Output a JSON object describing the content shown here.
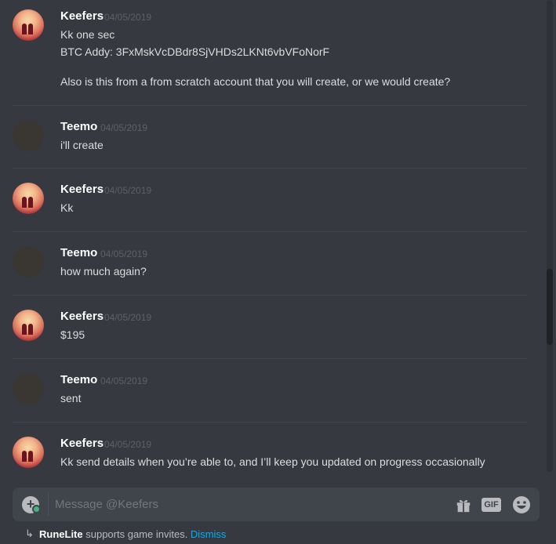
{
  "messages": [
    {
      "author": "Keefers",
      "time": "04/05/2019",
      "avatar": "keefers",
      "lines": [
        "Kk one sec",
        "BTC Addy: 3FxMskVcDBdr8SjVHDs2LKNt6vbVFoNorF",
        "",
        "Also is this from a from scratch account that you will create, or we would create?"
      ]
    },
    {
      "author": "Teemo",
      "time": "04/05/2019",
      "avatar": "teemo",
      "lines": [
        "i'll create"
      ]
    },
    {
      "author": "Keefers",
      "time": "04/05/2019",
      "avatar": "keefers",
      "lines": [
        "Kk"
      ]
    },
    {
      "author": "Teemo",
      "time": "04/05/2019",
      "avatar": "teemo",
      "lines": [
        "how much again?"
      ]
    },
    {
      "author": "Keefers",
      "time": "04/05/2019",
      "avatar": "keefers",
      "lines": [
        "$195"
      ]
    },
    {
      "author": "Teemo",
      "time": "04/05/2019",
      "avatar": "teemo",
      "lines": [
        "sent"
      ]
    },
    {
      "author": "Keefers",
      "time": "04/05/2019",
      "avatar": "keefers",
      "lines": [
        "Kk send details when you’re able to, and I’ll keep you updated on progress occasionally"
      ]
    }
  ],
  "composer": {
    "placeholder": "Message @Keefers",
    "gif_label": "GIF",
    "icons": [
      "attach-plus-icon",
      "gift-icon",
      "gif-icon",
      "emoji-icon"
    ]
  },
  "footer": {
    "app_name": "RuneLite",
    "text": " supports game invites. ",
    "dismiss": "Dismiss"
  },
  "colors": {
    "background": "#36393f",
    "username": "#ffffff",
    "text": "#dcddde",
    "timestamp": "#5d6066",
    "link": "#00b0f4",
    "composer": "#40444b"
  }
}
